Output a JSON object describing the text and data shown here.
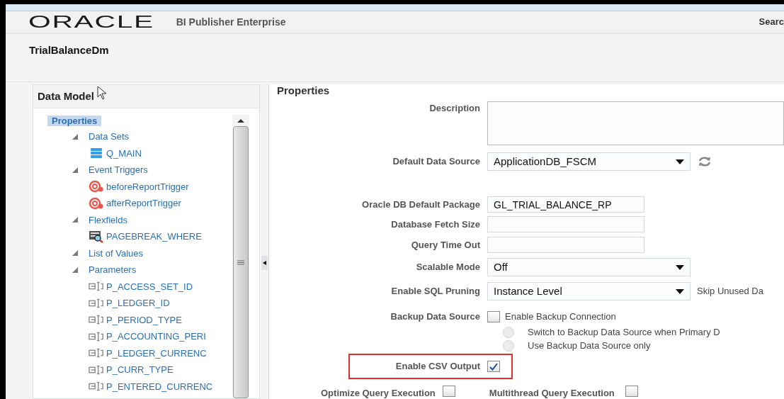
{
  "header": {
    "logo": "ORACLE",
    "product": "BI Publisher Enterprise",
    "search": "Searc"
  },
  "title": "TrialBalanceDm",
  "data_model": {
    "title": "Data Model",
    "tree": {
      "label": "Properties",
      "selected": true,
      "children": [
        {
          "label": "Data Sets",
          "expanded": true,
          "children": [
            {
              "label": "Q_MAIN",
              "kind": "dataset"
            }
          ]
        },
        {
          "label": "Event Triggers",
          "expanded": true,
          "children": [
            {
              "label": "beforeReportTrigger",
              "kind": "trigger"
            },
            {
              "label": "afterReportTrigger",
              "kind": "trigger"
            }
          ]
        },
        {
          "label": "Flexfields",
          "expanded": true,
          "children": [
            {
              "label": "PAGEBREAK_WHERE",
              "kind": "flexfield"
            }
          ]
        },
        {
          "label": "List of Values",
          "expanded": true
        },
        {
          "label": "Parameters",
          "expanded": true,
          "children": [
            {
              "label": "P_ACCESS_SET_ID",
              "kind": "parameter"
            },
            {
              "label": "P_LEDGER_ID",
              "kind": "parameter"
            },
            {
              "label": "P_PERIOD_TYPE",
              "kind": "parameter"
            },
            {
              "label": "P_ACCOUNTING_PERI",
              "kind": "parameter"
            },
            {
              "label": "P_LEDGER_CURRENC",
              "kind": "parameter"
            },
            {
              "label": "P_CURR_TYPE",
              "kind": "parameter"
            },
            {
              "label": "P_ENTERED_CURRENC",
              "kind": "parameter"
            }
          ]
        }
      ]
    }
  },
  "properties": {
    "title": "Properties",
    "rows": [
      {
        "kind": "textarea",
        "label": "Description"
      },
      {
        "kind": "select",
        "label": "Default Data Source",
        "value": "ApplicationDB_FSCM",
        "refresh": true
      },
      {
        "kind": "text",
        "label": "Oracle DB Default Package",
        "value": "GL_TRIAL_BALANCE_RP"
      },
      {
        "kind": "text",
        "label": "Database Fetch Size"
      },
      {
        "kind": "text",
        "label": "Query Time Out"
      },
      {
        "kind": "select",
        "label": "Scalable Mode",
        "value": "Off"
      },
      {
        "kind": "select",
        "label": "Enable SQL Pruning",
        "value": "Instance Level",
        "note": "Skip Unused Da"
      },
      {
        "kind": "checkbox",
        "label": "Backup Data Source",
        "checked": false,
        "text": "Enable Backup Connection",
        "highlighted": false
      },
      {
        "kind": "radio",
        "options": [
          {
            "label": "Switch to Backup Data Source when Primary D",
            "selected": false
          },
          {
            "label": "Use Backup Data Source only",
            "selected": false
          }
        ]
      },
      {
        "kind": "checkbox",
        "label": "Enable CSV Output",
        "checked": true,
        "highlighted": true
      },
      {
        "kind": "checkbox_pair",
        "items": [
          {
            "label": "Optimize Query Execution",
            "checked": false
          },
          {
            "label": "Multithread Query Execution",
            "checked": false
          }
        ]
      }
    ]
  }
}
